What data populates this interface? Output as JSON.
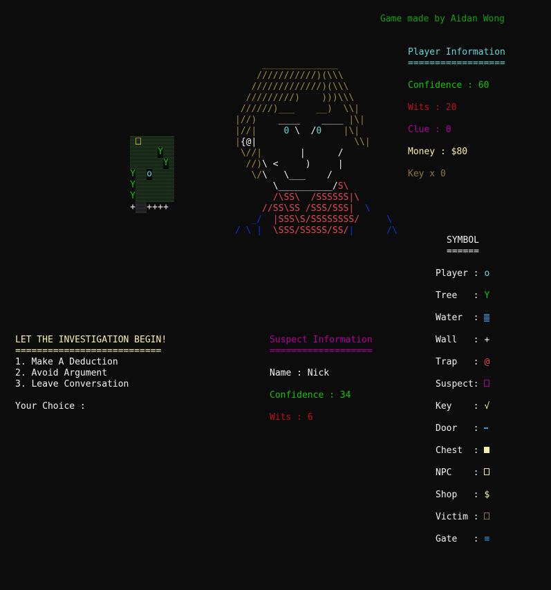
{
  "credit": "Game made by Aidan Wong",
  "player": {
    "header": "Player Information",
    "underline": "==================",
    "confidence": "Confidence : 60",
    "wits": "Wits : 20",
    "clue": "Clue : 0",
    "money": "Money : $80",
    "key": "Key x 0"
  },
  "map_rows": [
    [
      {
        "t": "w"
      },
      {
        "t": "box",
        "c": "yellow"
      },
      {
        "t": "w"
      },
      {
        "t": "w"
      },
      {
        "t": "w"
      },
      {
        "t": "w"
      },
      {
        "t": "w"
      },
      {
        "t": "w"
      }
    ],
    [
      {
        "t": "w"
      },
      {
        "t": "w"
      },
      {
        "t": "w"
      },
      {
        "t": "w"
      },
      {
        "t": "w"
      },
      {
        "t": "ch",
        "v": "Y",
        "c": "lgreen"
      },
      {
        "t": "w"
      },
      {
        "t": "w"
      }
    ],
    [
      {
        "t": "w"
      },
      {
        "t": "w"
      },
      {
        "t": "w"
      },
      {
        "t": "w"
      },
      {
        "t": "w"
      },
      {
        "t": "w"
      },
      {
        "t": "ch",
        "v": "Y",
        "c": "lgreen"
      },
      {
        "t": "w"
      }
    ],
    [
      {
        "t": "ch",
        "v": "Y",
        "c": "lgreen"
      },
      {
        "t": "w"
      },
      {
        "t": "w"
      },
      {
        "t": "ch",
        "v": "o",
        "c": "lcyan"
      },
      {
        "t": "w"
      },
      {
        "t": "w"
      },
      {
        "t": "w"
      },
      {
        "t": "w"
      }
    ],
    [
      {
        "t": "ch",
        "v": "Y",
        "c": "lgreen"
      },
      {
        "t": "w"
      },
      {
        "t": "w"
      },
      {
        "t": "w"
      },
      {
        "t": "w"
      },
      {
        "t": "w"
      },
      {
        "t": "w"
      },
      {
        "t": "w"
      }
    ],
    [
      {
        "t": "ch",
        "v": "Y",
        "c": "lgreen"
      },
      {
        "t": "w"
      },
      {
        "t": "w"
      },
      {
        "t": "w"
      },
      {
        "t": "w"
      },
      {
        "t": "w"
      },
      {
        "t": "w"
      },
      {
        "t": "w"
      }
    ],
    [
      {
        "t": "ch",
        "v": "+",
        "c": "white"
      },
      {
        "t": "w2"
      },
      {
        "t": "w2"
      },
      {
        "t": "ch",
        "v": "+",
        "c": "white"
      },
      {
        "t": "ch",
        "v": "+",
        "c": "white"
      },
      {
        "t": "ch",
        "v": "+",
        "c": "white"
      },
      {
        "t": "ch",
        "v": "+",
        "c": "white"
      },
      {
        "t": "sp"
      }
    ]
  ],
  "face_art": [
    [
      {
        "c": "dyellow",
        "s": "     ______________"
      }
    ],
    [
      {
        "c": "dyellow",
        "s": "    ///////////)(\\\\\\"
      }
    ],
    [
      {
        "c": "dyellow",
        "s": "   /////////////)(\\\\\\"
      }
    ],
    [
      {
        "c": "dyellow",
        "s": "  /////////)    )))\\\\\\"
      }
    ],
    [
      {
        "c": "dyellow",
        "s": " //////)___    __)  \\\\|"
      }
    ],
    [
      {
        "c": "dyellow",
        "s": "|//)"
      },
      {
        "c": "white",
        "s": "    ____    ____ "
      },
      {
        "c": "dyellow",
        "s": "|\\|"
      }
    ],
    [
      {
        "c": "dyellow",
        "s": "|//|"
      },
      {
        "c": "white",
        "s": "     "
      },
      {
        "c": "lcyan",
        "s": "0"
      },
      {
        "c": "white",
        "s": " \\  /"
      },
      {
        "c": "lcyan",
        "s": "0"
      },
      {
        "c": "white",
        "s": "    "
      },
      {
        "c": "dyellow",
        "s": "|\\|"
      }
    ],
    [
      {
        "c": "dyellow",
        "s": "|"
      },
      {
        "c": "white",
        "s": "{@|"
      },
      {
        "c": "white",
        "s": "                  "
      },
      {
        "c": "dyellow",
        "s": "\\\\|"
      }
    ],
    [
      {
        "c": "dyellow",
        "s": " \\//|"
      },
      {
        "c": "white",
        "s": "       |      /"
      }
    ],
    [
      {
        "c": "dyellow",
        "s": "  //)"
      },
      {
        "c": "white",
        "s": "\\ <     )     |"
      }
    ],
    [
      {
        "c": "dyellow",
        "s": "   \\/"
      },
      {
        "c": "white",
        "s": "\\   \\___    /"
      }
    ],
    [
      {
        "c": "white",
        "s": "       \\__________/"
      },
      {
        "c": "lred",
        "s": "S\\"
      }
    ],
    [
      {
        "c": "lred",
        "s": "       /\\SS\\  /SSSSSS|\\"
      }
    ],
    [
      {
        "c": "lred",
        "s": "     //SS\\SS /SSS/SSS|"
      },
      {
        "c": "blue",
        "s": "  \\"
      }
    ],
    [
      {
        "c": "blue",
        "s": "   _/  "
      },
      {
        "c": "lred",
        "s": "|SSS\\S/SSSSSSSS/"
      },
      {
        "c": "blue",
        "s": "     \\"
      }
    ],
    [
      {
        "c": "blue",
        "s": "/ \\ | "
      },
      {
        "c": "lred",
        "s": " \\SSS/SSSSS/SS/"
      },
      {
        "c": "blue",
        "s": "|      /\\"
      }
    ]
  ],
  "investigation": {
    "title": "LET THE INVESTIGATION BEGIN!",
    "underline": "===========================",
    "options": [
      "1. Make A Deduction",
      "2. Avoid Argument",
      "3. Leave Conversation"
    ],
    "prompt": "Your Choice :"
  },
  "suspect": {
    "header": "Suspect Information",
    "underline": "===================",
    "name": "Name : Nick",
    "confidence": "Confidence : 34",
    "wits": "Wits : 6"
  },
  "symbols": {
    "title": "SYMBOL",
    "underline": "======",
    "items": [
      {
        "label": "Player : ",
        "glyph": "o",
        "color": "#61d6d6",
        "kind": "text"
      },
      {
        "label": "Tree   : ",
        "glyph": "Y",
        "color": "#16c60c",
        "kind": "text"
      },
      {
        "label": "Water  : ",
        "glyph": "",
        "color": "#3a96dd",
        "kind": "water"
      },
      {
        "label": "Wall   : ",
        "glyph": "+",
        "color": "#f2f2f2",
        "kind": "text"
      },
      {
        "label": "Trap   : ",
        "glyph": "@",
        "color": "#e74856",
        "kind": "text"
      },
      {
        "label": "Suspect: ",
        "glyph": "",
        "color": "#b4009e",
        "kind": "box"
      },
      {
        "label": "Key    : ",
        "glyph": "√",
        "color": "#f9f1a5",
        "kind": "text"
      },
      {
        "label": "Door   : ",
        "glyph": "",
        "color": "#3a96dd",
        "kind": "door"
      },
      {
        "label": "Chest  : ",
        "glyph": "",
        "color": "#f9f1a5",
        "kind": "chest"
      },
      {
        "label": "NPC    : ",
        "glyph": "",
        "color": "#f9f1a5",
        "kind": "box"
      },
      {
        "label": "Shop   : ",
        "glyph": "$",
        "color": "#f9f1a5",
        "kind": "text"
      },
      {
        "label": "Victim : ",
        "glyph": "",
        "color": "#8a7a3c",
        "kind": "box"
      },
      {
        "label": "Gate   : ",
        "glyph": "≡",
        "color": "#3a96dd",
        "kind": "text"
      }
    ]
  }
}
